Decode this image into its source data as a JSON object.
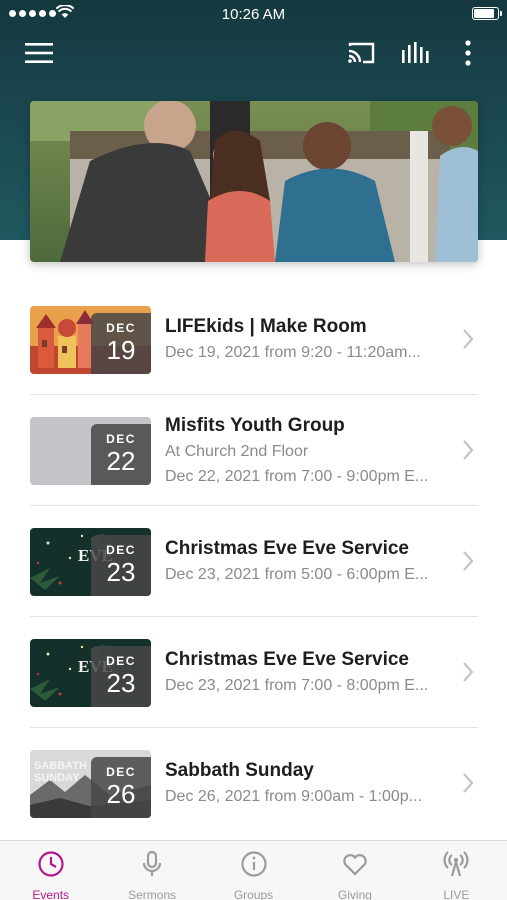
{
  "status_bar": {
    "time": "10:26 AM",
    "signal_bars": 5,
    "battery_level": 0.9
  },
  "nav": {
    "icons": [
      "menu-icon",
      "cast-icon",
      "audio-bars-icon",
      "more-vertical-icon"
    ]
  },
  "colors": {
    "header": "#1c4a52",
    "accent": "#b3178d",
    "title_text": "#1e1e1e",
    "subtitle_text": "#8a8a8a",
    "tab_inactive": "#9b9b9b"
  },
  "events": [
    {
      "title": "LIFEkids | Make Room",
      "lines": [
        "Dec 19, 2021 from 9:20 - 11:20am..."
      ],
      "month": "DEC",
      "day": "19",
      "thumb_style": "lifekids"
    },
    {
      "title": "Misfits Youth Group",
      "lines": [
        "At Church 2nd Floor",
        "Dec 22, 2021 from 7:00 - 9:00pm E..."
      ],
      "month": "DEC",
      "day": "22",
      "thumb_style": "gray"
    },
    {
      "title": "Christmas Eve Eve Service",
      "lines": [
        "Dec 23, 2021 from 5:00 - 6:00pm E..."
      ],
      "month": "DEC",
      "day": "23",
      "thumb_style": "christmas",
      "thumb_text": "EVE"
    },
    {
      "title": "Christmas Eve Eve Service",
      "lines": [
        "Dec 23, 2021 from 7:00 - 8:00pm E..."
      ],
      "month": "DEC",
      "day": "23",
      "thumb_style": "christmas",
      "thumb_text": "EVE"
    },
    {
      "title": "Sabbath Sunday",
      "lines": [
        "Dec 26, 2021 from 9:00am - 1:00p..."
      ],
      "month": "DEC",
      "day": "26",
      "thumb_style": "mountain",
      "thumb_text": "SABBATH SUNDAY"
    }
  ],
  "tabs": [
    {
      "label": "Events",
      "icon": "clock-icon",
      "active": true
    },
    {
      "label": "Sermons",
      "icon": "microphone-icon",
      "active": false
    },
    {
      "label": "Groups",
      "icon": "info-icon",
      "active": false
    },
    {
      "label": "Giving",
      "icon": "heart-icon",
      "active": false
    },
    {
      "label": "LIVE",
      "icon": "broadcast-icon",
      "active": false
    }
  ]
}
